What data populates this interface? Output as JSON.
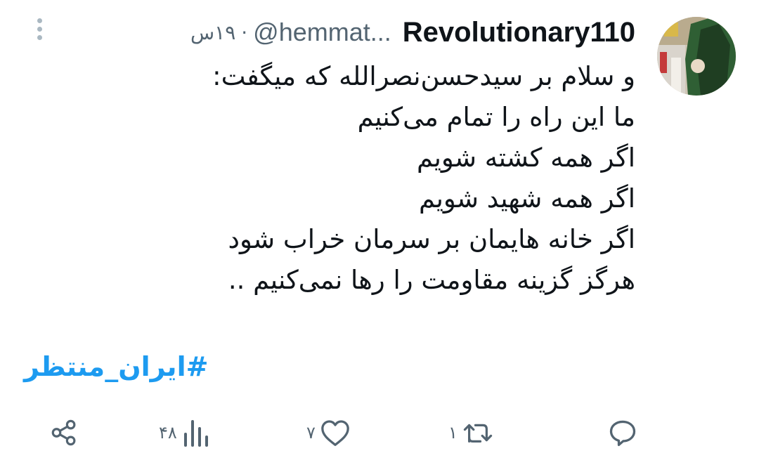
{
  "tweet": {
    "display_name": "Revolutionary110",
    "handle": "@hemmat...",
    "separator": "·",
    "time": "۱۹س",
    "lines": [
      "و سلام بر سیدحسن‌نصرالله که میگفت:",
      "ما این راه را تمام می‌کنیم",
      "اگر همه کشته شویم",
      "اگر همه شهید شویم",
      "اگر خانه هایمان بر سرمان خراب شود",
      "هرگز گزینه مقاومت را رها نمی‌کنیم .."
    ],
    "hashtag": "#ایران_منتظر"
  },
  "actions": {
    "reply_count": "",
    "retweet_count": "۱",
    "like_count": "۷",
    "views_count": "۴۸"
  },
  "icons": {
    "more": "more-vertical-icon",
    "reply": "reply-icon",
    "retweet": "retweet-icon",
    "like": "heart-icon",
    "views": "views-icon",
    "share": "share-icon"
  },
  "colors": {
    "text": "#0f1419",
    "secondary": "#536471",
    "link": "#1d9bf0"
  }
}
